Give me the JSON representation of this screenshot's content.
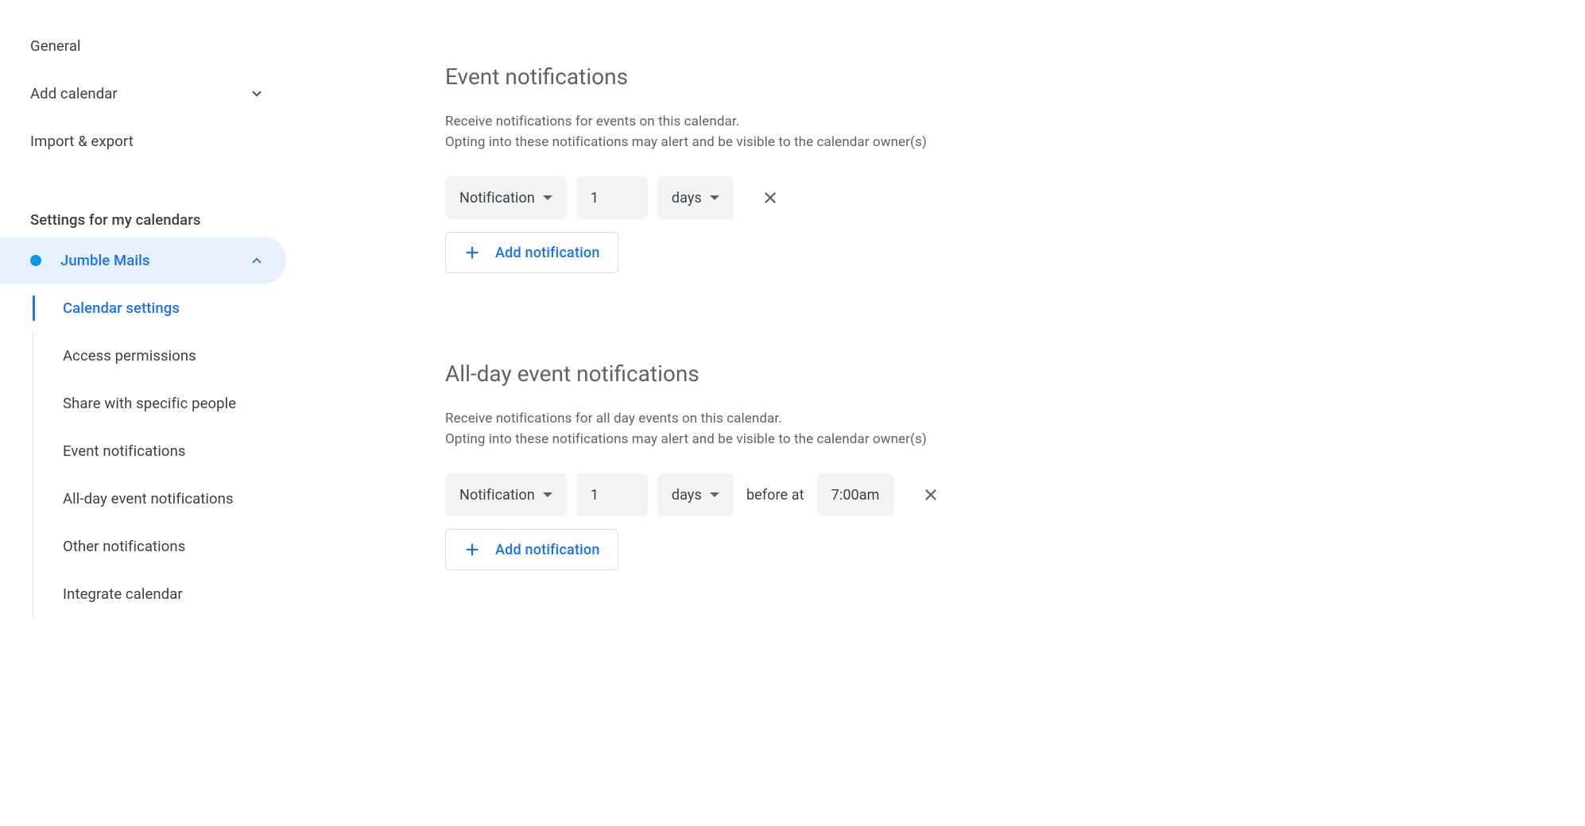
{
  "sidebar": {
    "top_nav": [
      {
        "label": "General",
        "has_chevron": false
      },
      {
        "label": "Add calendar",
        "has_chevron": true
      },
      {
        "label": "Import & export",
        "has_chevron": false
      }
    ],
    "section_header": "Settings for my calendars",
    "calendar_name": "Jumble Mails",
    "sub_items": [
      {
        "label": "Calendar settings",
        "active": true
      },
      {
        "label": "Access permissions",
        "active": false
      },
      {
        "label": "Share with specific people",
        "active": false
      },
      {
        "label": "Event notifications",
        "active": false
      },
      {
        "label": "All-day event notifications",
        "active": false
      },
      {
        "label": "Other notifications",
        "active": false
      },
      {
        "label": "Integrate calendar",
        "active": false
      }
    ]
  },
  "main": {
    "event_notifications": {
      "title": "Event notifications",
      "desc_line1": "Receive notifications for events on this calendar.",
      "desc_line2": "Opting into these notifications may alert and be visible to the calendar owner(s)",
      "row": {
        "type": "Notification",
        "value": "1",
        "unit": "days"
      },
      "add_button": "Add notification"
    },
    "allday_notifications": {
      "title": "All-day event notifications",
      "desc_line1": "Receive notifications for all day events on this calendar.",
      "desc_line2": "Opting into these notifications may alert and be visible to the calendar owner(s)",
      "row": {
        "type": "Notification",
        "value": "1",
        "unit": "days",
        "before_at": "before at",
        "time": "7:00am"
      },
      "add_button": "Add notification"
    }
  }
}
